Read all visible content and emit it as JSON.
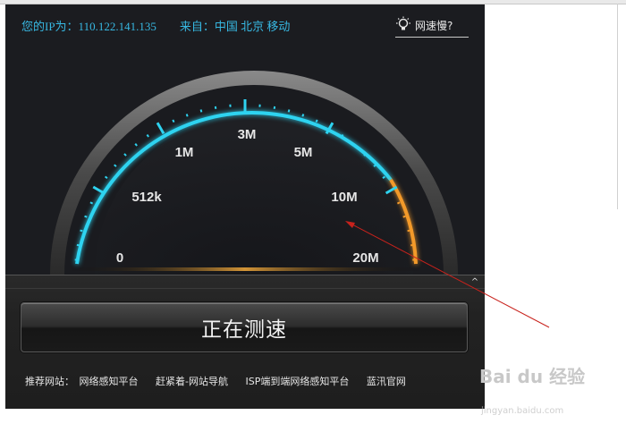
{
  "header": {
    "ip_text": "您的IP为：110.122.141.135　　来自：中国 北京 移动",
    "help_label": "网速慢?"
  },
  "gauge": {
    "labels": [
      "0",
      "512k",
      "1M",
      "3M",
      "5M",
      "10M",
      "20M"
    ]
  },
  "main": {
    "test_button_label": "正在测速",
    "collapse_glyph": "^"
  },
  "links": {
    "label": "推荐网站：",
    "items": [
      "网络感知平台",
      "赶紧着-网站导航",
      "ISP端到端网络感知平台",
      "蓝汛官网"
    ]
  },
  "watermark": {
    "brand": "Bai du 经验",
    "url": "jingyan.baidu.com"
  },
  "colors": {
    "accent_cyan": "#2ed3f0",
    "accent_orange": "#f39a2a",
    "ip_blue": "#37b8e2",
    "arrow_red": "#c8221c"
  }
}
